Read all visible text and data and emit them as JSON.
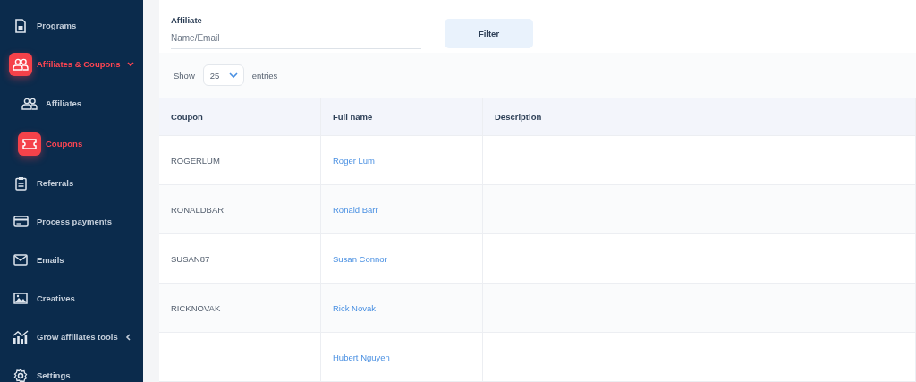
{
  "sidebar": {
    "items": [
      {
        "label": "Programs",
        "selected": false
      },
      {
        "label": "Affiliates & Coupons",
        "selected": true,
        "expanded": true,
        "children": [
          {
            "label": "Affiliates",
            "selected": false
          },
          {
            "label": "Coupons",
            "selected": true
          }
        ]
      },
      {
        "label": "Referrals",
        "selected": false
      },
      {
        "label": "Process payments",
        "selected": false
      },
      {
        "label": "Emails",
        "selected": false
      },
      {
        "label": "Creatives",
        "selected": false
      },
      {
        "label": "Grow affiliates tools",
        "selected": false,
        "expanded": false
      },
      {
        "label": "Settings",
        "selected": false
      }
    ]
  },
  "filter": {
    "label": "Affiliate",
    "placeholder": "Name/Email",
    "button": "Filter"
  },
  "entries": {
    "show": "Show",
    "value": "25",
    "suffix": "entries"
  },
  "table": {
    "columns": [
      "Coupon",
      "Full name",
      "Description"
    ],
    "rows": [
      {
        "coupon": "ROGERLUM",
        "name": "Roger Lum"
      },
      {
        "coupon": "RONALDBAR",
        "name": "Ronald Barr"
      },
      {
        "coupon": "SUSAN87",
        "name": "Susan Connor"
      },
      {
        "coupon": "RICKNOVAK",
        "name": "Rick Novak"
      },
      {
        "coupon": "",
        "name": "Hubert Nguyen"
      }
    ]
  }
}
